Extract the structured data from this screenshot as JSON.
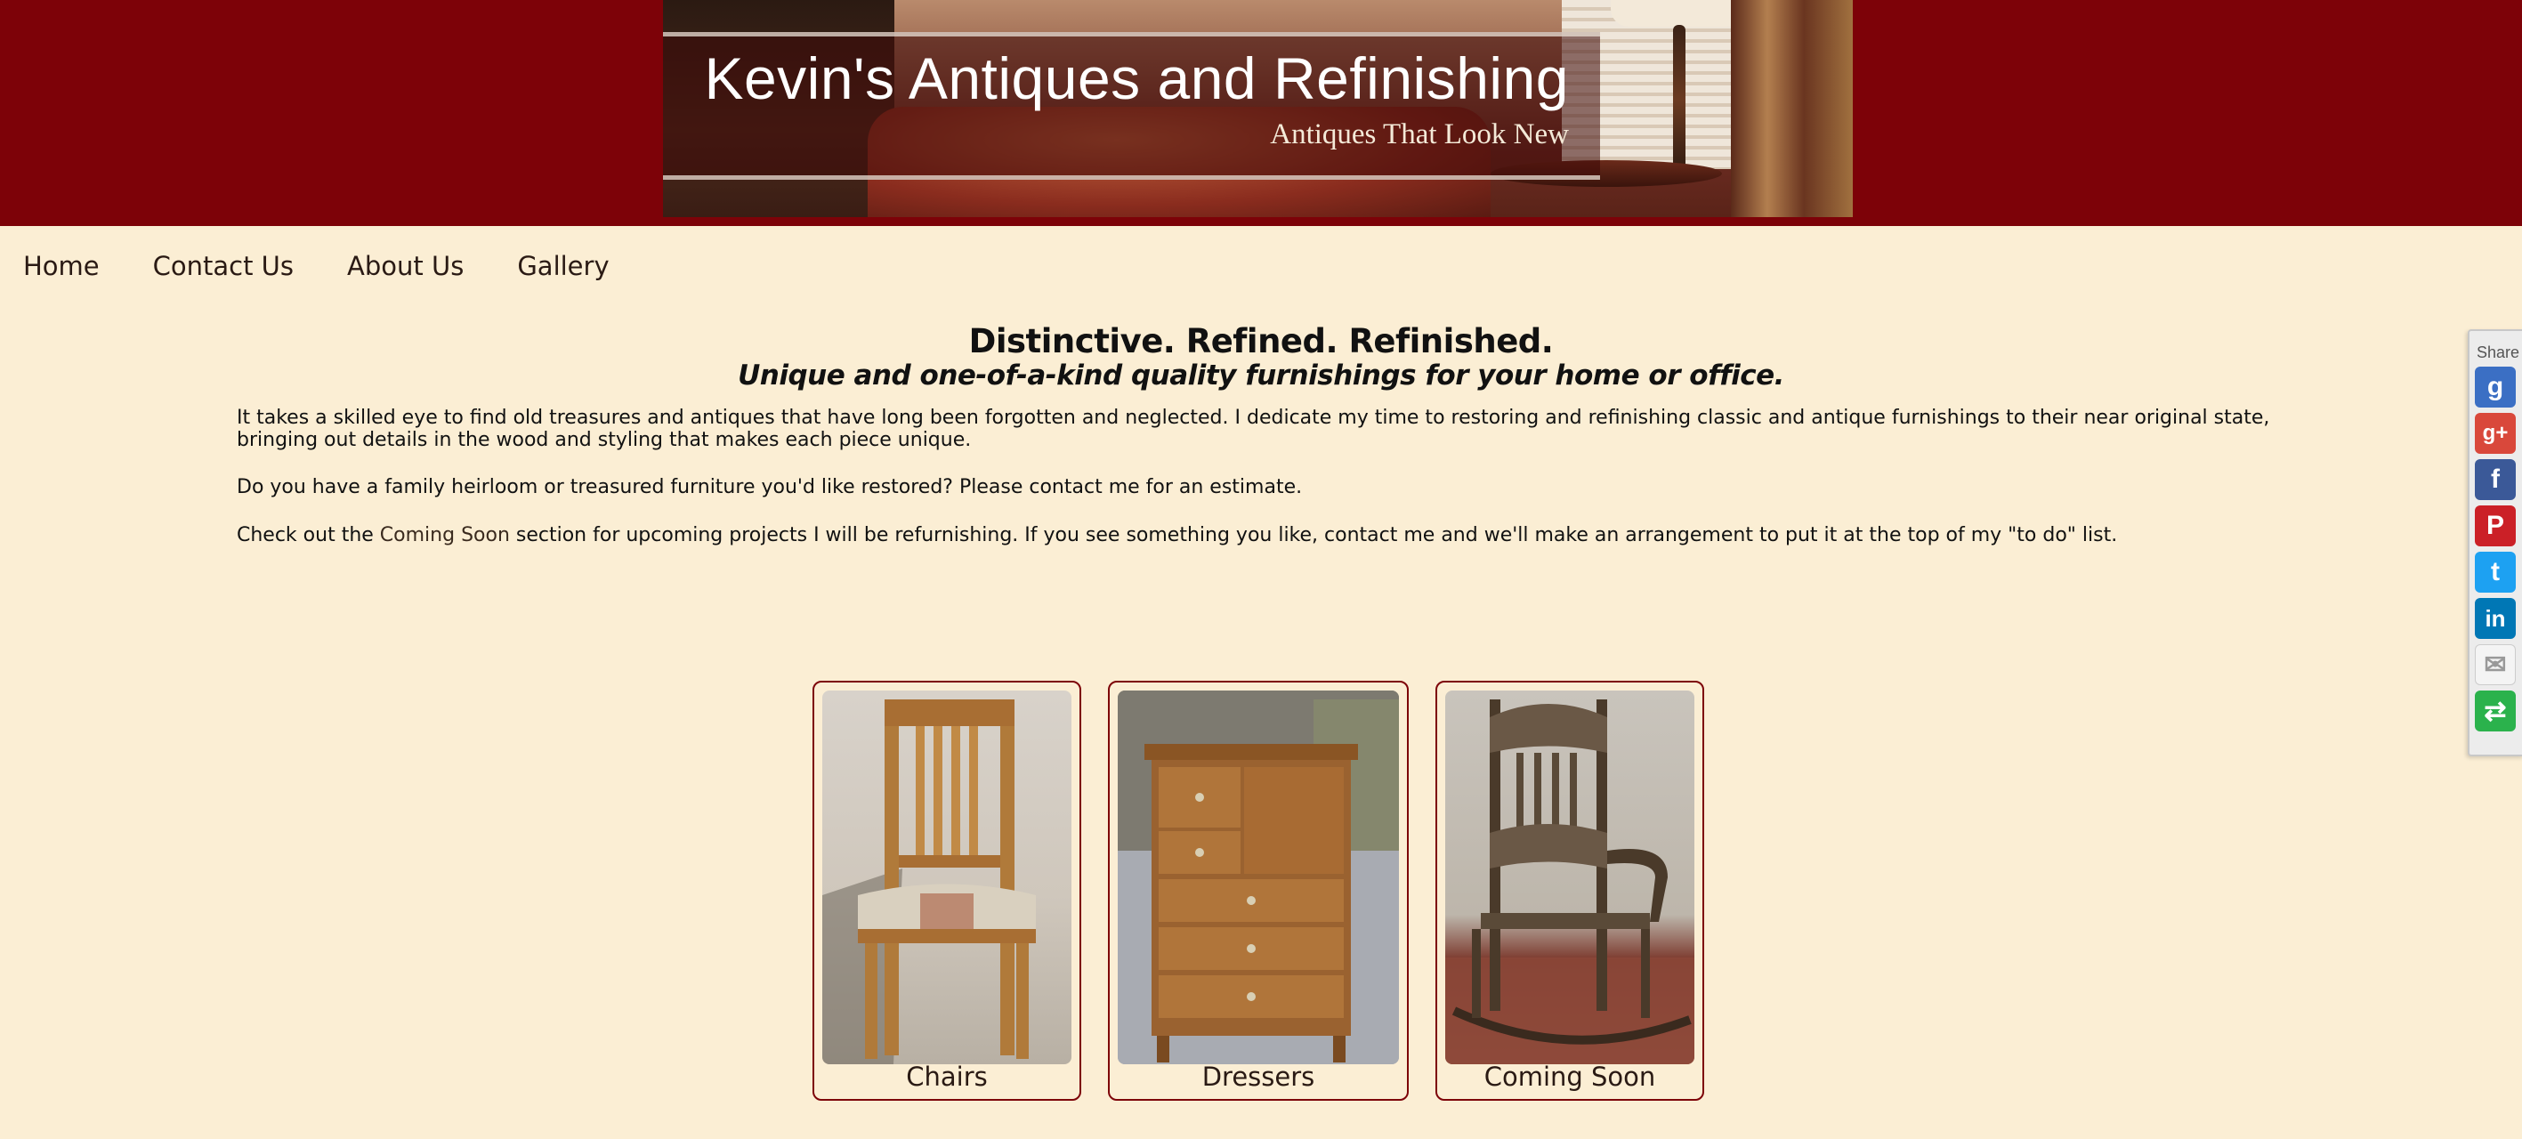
{
  "header": {
    "title": "Kevin's Antiques and Refinishing",
    "tagline": "Antiques That Look New"
  },
  "nav": {
    "items": [
      {
        "label": "Home"
      },
      {
        "label": "Contact Us"
      },
      {
        "label": "About Us"
      },
      {
        "label": "Gallery"
      }
    ]
  },
  "main": {
    "heading": "Distinctive. Refined. Refinished.",
    "subheading": "Unique and one-of-a-kind quality furnishings for your home or office.",
    "paragraph1": "It takes a skilled eye to find old treasures and antiques that have long been forgotten and neglected. I dedicate my time to restoring and refinishing classic and antique furnishings to their near original state, bringing out details in the wood and styling that makes each piece unique.",
    "paragraph2": "Do you have a family heirloom or treasured furniture you'd like restored? Please contact me for an estimate.",
    "paragraph3_before": "Check out the ",
    "paragraph3_link": "Coming Soon",
    "paragraph3_after": " section for upcoming projects I will be refurnishing. If you see something you like, contact me and we'll make an arrangement to put it at the top of my \"to do\" list."
  },
  "gallery": {
    "cards": [
      {
        "label": "Chairs"
      },
      {
        "label": "Dressers"
      },
      {
        "label": "Coming Soon"
      }
    ]
  },
  "sharebar": {
    "label": "Share",
    "buttons": [
      {
        "icon": "google-icon",
        "color": "#3b6fc4",
        "glyph": "g"
      },
      {
        "icon": "google-plus-icon",
        "color": "#d9483b",
        "glyph": "g+"
      },
      {
        "icon": "facebook-icon",
        "color": "#3b5998",
        "glyph": "f"
      },
      {
        "icon": "pinterest-icon",
        "color": "#cb2027",
        "glyph": "P"
      },
      {
        "icon": "twitter-icon",
        "color": "#1da1f2",
        "glyph": "t"
      },
      {
        "icon": "linkedin-icon",
        "color": "#0077b5",
        "glyph": "in"
      },
      {
        "icon": "email-icon",
        "color": "#f4f4f4",
        "glyph": "✉"
      },
      {
        "icon": "share-icon",
        "color": "#2bb24c",
        "glyph": "⇄"
      }
    ]
  }
}
